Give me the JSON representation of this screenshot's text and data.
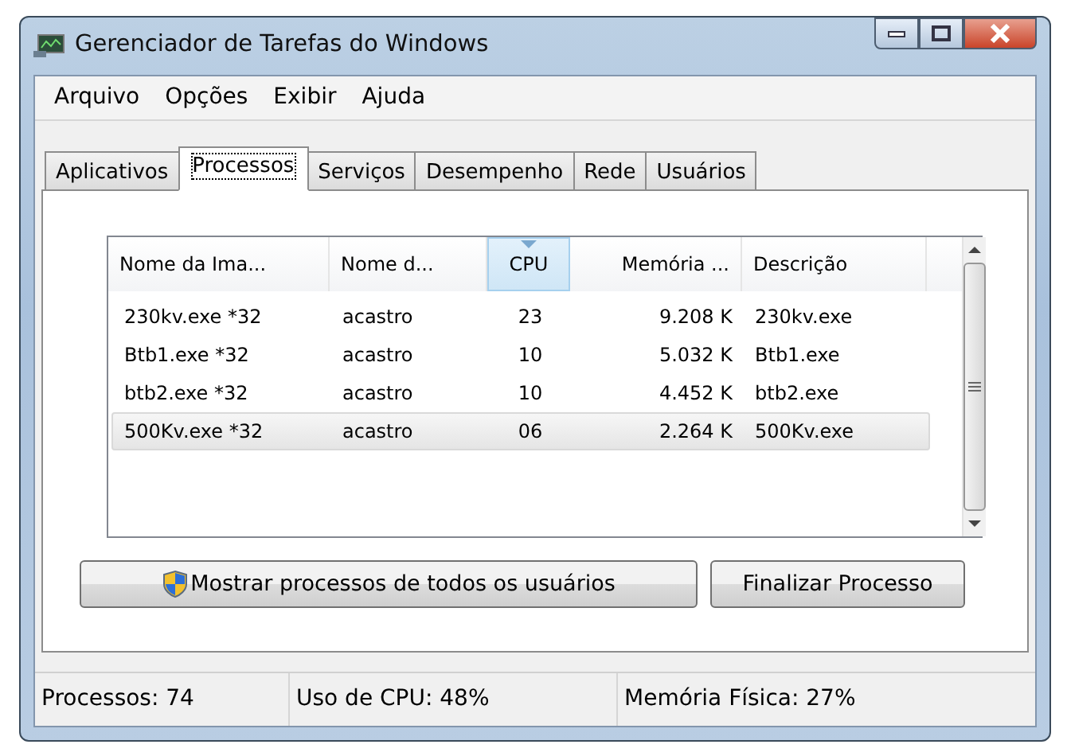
{
  "window": {
    "title": "Gerenciador de Tarefas do Windows"
  },
  "menu": [
    "Arquivo",
    "Opções",
    "Exibir",
    "Ajuda"
  ],
  "tabs": [
    {
      "label": "Aplicativos",
      "selected": false
    },
    {
      "label": "Processos",
      "selected": true
    },
    {
      "label": "Serviços",
      "selected": false
    },
    {
      "label": "Desempenho",
      "selected": false
    },
    {
      "label": "Rede",
      "selected": false
    },
    {
      "label": "Usuários",
      "selected": false
    }
  ],
  "table": {
    "columns": [
      {
        "label": "Nome da Ima...",
        "sorted": false
      },
      {
        "label": "Nome d...",
        "sorted": false
      },
      {
        "label": "CPU",
        "sorted": true
      },
      {
        "label": "Memória ...",
        "sorted": false
      },
      {
        "label": "Descrição",
        "sorted": false
      }
    ],
    "rows": [
      {
        "cells": [
          "230kv.exe *32",
          "acastro",
          "23",
          "9.208 K",
          "230kv.exe"
        ],
        "selected": false
      },
      {
        "cells": [
          "Btb1.exe *32",
          "acastro",
          "10",
          "5.032 K",
          "Btb1.exe"
        ],
        "selected": false
      },
      {
        "cells": [
          "btb2.exe *32",
          "acastro",
          "10",
          "4.452 K",
          "btb2.exe"
        ],
        "selected": false
      },
      {
        "cells": [
          "500Kv.exe *32",
          "acastro",
          "06",
          "2.264 K",
          "500Kv.exe"
        ],
        "selected": true
      }
    ]
  },
  "buttons": [
    {
      "label": "Mostrar processos de todos os usuários",
      "kind": "shield"
    },
    {
      "label": "Finalizar Processo",
      "kind": "plain"
    }
  ],
  "status_bar": [
    "Processos: 74",
    "Uso de CPU: 48%",
    "Memória Física: 27%"
  ]
}
